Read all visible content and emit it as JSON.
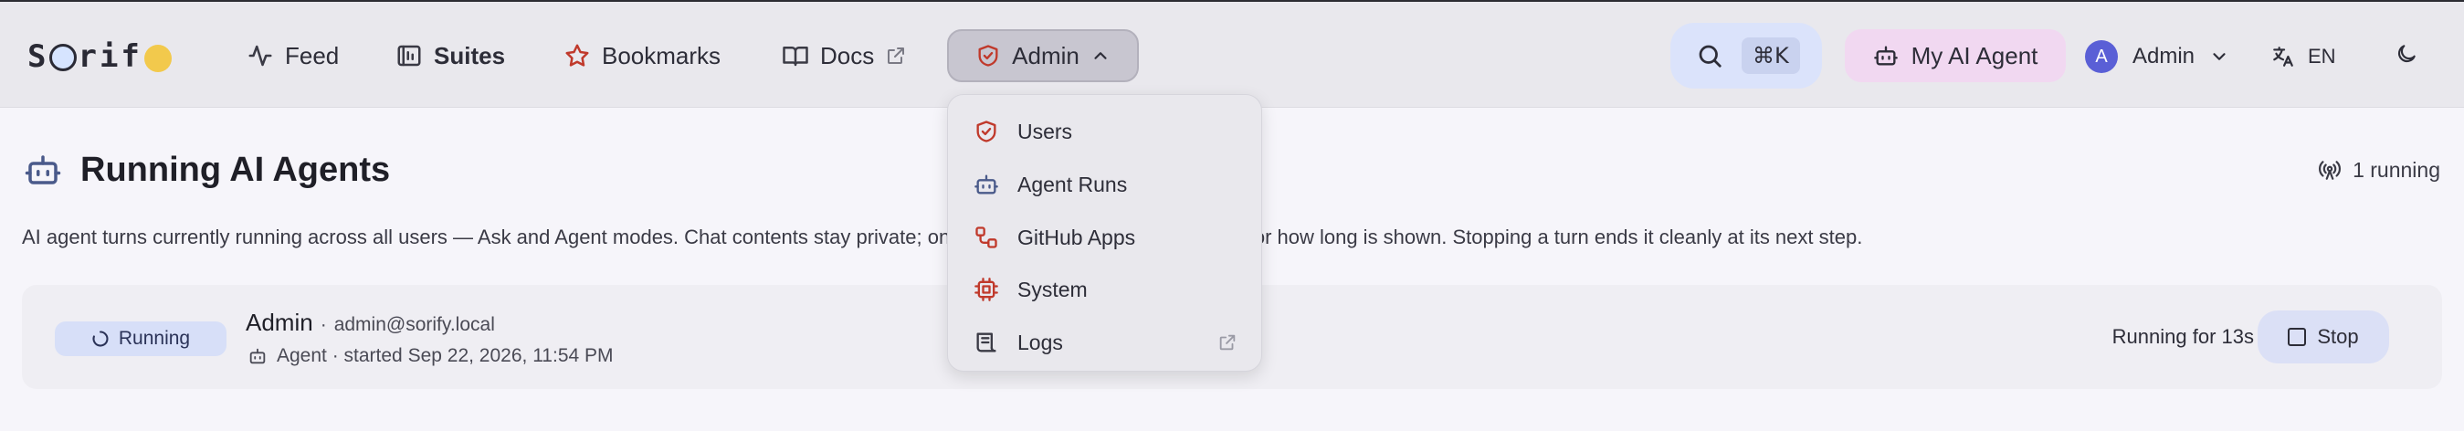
{
  "brand": {
    "logo_text": "S",
    "logo_o": "o",
    "logo_rest": "rif"
  },
  "nav": {
    "feed": "Feed",
    "suites": "Suites",
    "bookmarks": "Bookmarks",
    "docs": "Docs",
    "admin": "Admin"
  },
  "search": {
    "shortcut": "⌘K"
  },
  "agent_button": "My AI Agent",
  "user": {
    "initial": "A",
    "name": "Admin"
  },
  "language": "EN",
  "admin_menu": {
    "items": [
      {
        "label": "Users",
        "icon": "shield-check-icon"
      },
      {
        "label": "Agent Runs",
        "icon": "robot-icon"
      },
      {
        "label": "GitHub Apps",
        "icon": "workflow-icon"
      },
      {
        "label": "System",
        "icon": "cpu-icon"
      },
      {
        "label": "Logs",
        "icon": "scroll-icon",
        "external": true
      }
    ]
  },
  "page": {
    "title": "Running AI Agents",
    "running_count": "1 running",
    "description": "AI agent turns currently running across all users — Ask and Agent modes. Chat contents stay private; only who is running what mode and for how long is shown. Stopping a turn ends it cleanly at its next step."
  },
  "turns": [
    {
      "status": "Running",
      "user_name": "Admin",
      "separator": "·",
      "email": "admin@sorify.local",
      "meta": "Agent · started Sep 22, 2026, 11:54 PM",
      "duration": "Running for 13s",
      "stop_label": "Stop"
    }
  ],
  "colors": {
    "topbar_bg": "#e9e8ed",
    "accent_red": "#c0392b",
    "robot_blue": "#4a5a8a",
    "search_bg": "#dbe3fb",
    "agent_pill_bg": "#f1d8f1",
    "status_badge_bg": "#d7dff8"
  }
}
